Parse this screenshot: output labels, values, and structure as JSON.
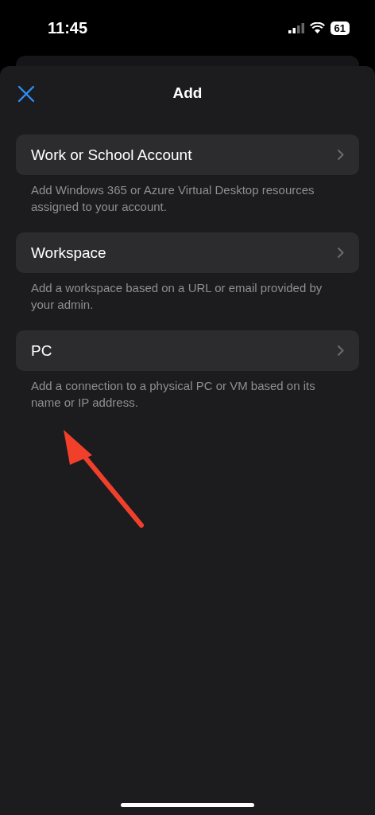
{
  "status_bar": {
    "time": "11:45",
    "battery": "61"
  },
  "header": {
    "title": "Add"
  },
  "options": [
    {
      "label": "Work or School Account",
      "description": "Add Windows 365 or Azure Virtual Desktop resources assigned to your account."
    },
    {
      "label": "Workspace",
      "description": "Add a workspace based on a URL or email provided by your admin."
    },
    {
      "label": "PC",
      "description": "Add a connection to a physical PC or VM based on its name or IP address."
    }
  ]
}
